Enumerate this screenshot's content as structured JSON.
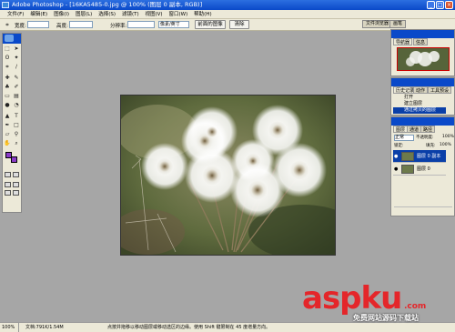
{
  "window": {
    "title": "Adobe Photoshop - [16KA5485-0.jpg @ 100% (图层 0 副本, RGB)]",
    "controls": [
      "_",
      "□",
      "×"
    ]
  },
  "menu": [
    "文件(F)",
    "编辑(E)",
    "图像(I)",
    "图层(L)",
    "选择(S)",
    "滤镜(T)",
    "视图(V)",
    "窗口(W)",
    "帮助(H)"
  ],
  "options": {
    "width_label": "宽度:",
    "height_label": "高度:",
    "resolution_label": "分辨率:",
    "unit_value": "像素/英寸",
    "front_image_button": "前面的图像",
    "clear_button": "清除",
    "file_browser_tab": "文件浏览器",
    "brushes_tab": "画笔"
  },
  "panels": {
    "navigator_tabs": [
      "导航器",
      "信息"
    ],
    "history_tabs": [
      "历史记录",
      "动作",
      "工具预设"
    ],
    "history_items": [
      "打开",
      "建立图层",
      "通过拷贝的图层"
    ],
    "layers_tabs": [
      "图层",
      "通道",
      "路径"
    ],
    "blend_mode": "正常",
    "opacity_label": "不透明度:",
    "opacity_value": "100%",
    "lock_label": "锁定:",
    "fill_label": "填充:",
    "fill_value": "100%",
    "layers": [
      "图层 0 副本",
      "图层 0"
    ]
  },
  "status": {
    "zoom": "100%",
    "doc_info": "文档:791K/1.54M",
    "hint": "点按并拖移以移动图层或移动选区的边缘。使用 Shift 键限制在 45 度增量方向。"
  },
  "watermark": {
    "text": "aspku",
    "domain_suffix": ".com",
    "sub": "免费网站源码下载站"
  },
  "colors": {
    "titlebar": "#0a49c9",
    "foreground_swatch": "#8a3cc8",
    "background_swatch": "#8a3cc8",
    "watermark": "#e4262a",
    "selection": "#0a3fa8"
  }
}
